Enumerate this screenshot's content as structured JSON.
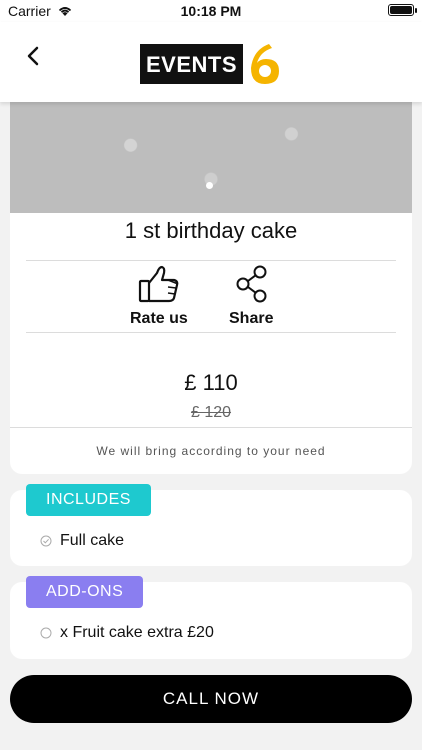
{
  "status": {
    "carrier": "Carrier",
    "time": "10:18 PM"
  },
  "brand": {
    "text": "EVENTS",
    "accent": "#f5b400"
  },
  "product": {
    "title": "1 st birthday cake",
    "rate_label": "Rate us",
    "share_label": "Share",
    "price": "£ 110",
    "old_price": "£ 120",
    "note": "We will bring according to your need"
  },
  "includes": {
    "tag": "INCLUDES",
    "tag_color": "#1ec9cf",
    "items": [
      "Full cake"
    ]
  },
  "addons": {
    "tag": "ADD-ONS",
    "tag_color": "#8a7ef0",
    "items": [
      "x Fruit cake extra £20"
    ]
  },
  "cta": {
    "label": "CALL NOW"
  }
}
